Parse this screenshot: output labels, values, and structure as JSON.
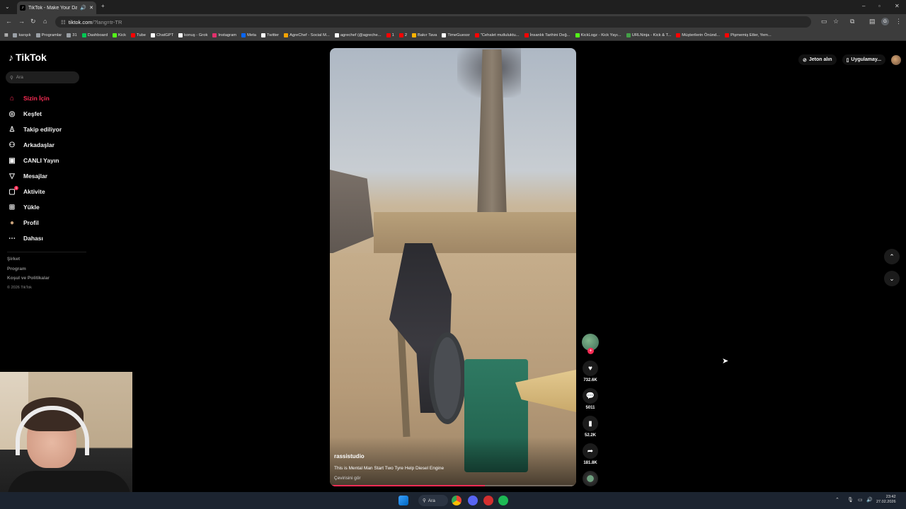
{
  "browser": {
    "tab_title": "TikTok - Make Your Day",
    "tab_favicon": "tiktok-icon",
    "url_host": "tiktok.com",
    "url_path": "/?lang=tr-TR",
    "profile_initial": "G",
    "bookmarks": [
      {
        "label": "karışık",
        "color": "#9aa0a6"
      },
      {
        "label": "Programlar",
        "color": "#9aa0a6"
      },
      {
        "label": "31",
        "color": "#9aa0a6"
      },
      {
        "label": "Dashboard",
        "color": "#00c853"
      },
      {
        "label": "Kick",
        "color": "#53fc18"
      },
      {
        "label": "Tube",
        "color": "#ff0000"
      },
      {
        "label": "ChatGPT",
        "color": "#ffffff"
      },
      {
        "label": "konuş - Grok",
        "color": "#ffffff"
      },
      {
        "label": "Instagram",
        "color": "#e1306c"
      },
      {
        "label": "Meta",
        "color": "#0866ff"
      },
      {
        "label": "Twitter",
        "color": "#ffffff"
      },
      {
        "label": "AgreChef - Social M...",
        "color": "#f4a300"
      },
      {
        "label": "agrechef (@agreche...",
        "color": "#ffffff"
      },
      {
        "label": "1",
        "color": "#ff0000"
      },
      {
        "label": "2",
        "color": "#ff0000"
      },
      {
        "label": "Bakır Tava",
        "color": "#ffb300"
      },
      {
        "label": "TimeGuessr",
        "color": "#ffffff"
      },
      {
        "label": "\"Cehalet mutluluktu...",
        "color": "#ff0000"
      },
      {
        "label": "İnsanlık Tarihini Değ...",
        "color": "#ff0000"
      },
      {
        "label": "KickLogz - Kick Yayı...",
        "color": "#53fc18"
      },
      {
        "label": "URLNinja - Kick & T...",
        "color": "#43a047"
      },
      {
        "label": "Müşterilerin Önünd...",
        "color": "#ff0000"
      },
      {
        "label": "Pişmemiş Etler, Yem...",
        "color": "#ff0000"
      }
    ]
  },
  "tiktok": {
    "logo_text": "TikTok",
    "search_placeholder": "Ara",
    "nav": [
      {
        "label": "Sizin İçin",
        "icon": "home-icon",
        "glyph": "⌂",
        "active": true
      },
      {
        "label": "Keşfet",
        "icon": "compass-icon",
        "glyph": "◎"
      },
      {
        "label": "Takip ediliyor",
        "icon": "following-icon",
        "glyph": "♙"
      },
      {
        "label": "Arkadaşlar",
        "icon": "friends-icon",
        "glyph": "⚇"
      },
      {
        "label": "CANLI Yayın",
        "icon": "live-icon",
        "glyph": "▣"
      },
      {
        "label": "Mesajlar",
        "icon": "messages-icon",
        "glyph": "▽"
      },
      {
        "label": "Aktivite",
        "icon": "activity-icon",
        "glyph": "▢",
        "badge": "1"
      },
      {
        "label": "Yükle",
        "icon": "upload-icon",
        "glyph": "⊞"
      },
      {
        "label": "Profil",
        "icon": "profile-avatar",
        "glyph": "●"
      },
      {
        "label": "Dahası",
        "icon": "more-icon",
        "glyph": "⋯"
      }
    ],
    "footer": {
      "company": "Şirket",
      "program": "Program",
      "terms": "Koşul ve Politikalar",
      "copyright": "© 2026 TikTok"
    },
    "top_right": {
      "coins_label": "Jeton alın",
      "app_label": "Uygulamay..."
    },
    "video": {
      "author": "rassistudio",
      "description": "This is Mental Man Start Two Tyre Help Diesel Engine",
      "translate": "Çevirisini gör",
      "progress": 0.63
    },
    "actions": {
      "likes": "732.6K",
      "comments": "5011",
      "saves": "52.2K",
      "shares": "181.8K"
    }
  },
  "taskbar": {
    "search_label": "Ara",
    "time": "23:42",
    "date": "27.02.2026"
  }
}
